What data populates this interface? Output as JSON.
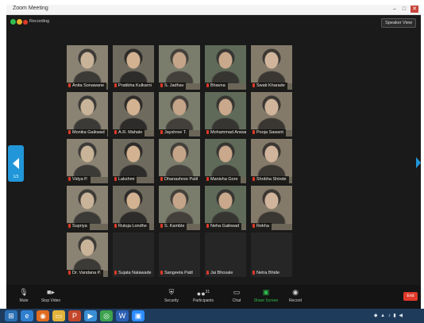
{
  "titlebar": {
    "app_title": "Zoom Meeting",
    "window_title": "",
    "minimize": "–",
    "maximize": "□",
    "close": "✕"
  },
  "topbar": {
    "recording_label": "Recording",
    "speaker_view_label": "Speaker View",
    "colors": {
      "recording": "#e0392b"
    }
  },
  "navigation": {
    "page_indicator": "1/3"
  },
  "gallery": {
    "tiles": [
      {
        "name": "Anita Sonawane",
        "video": true,
        "muted": true
      },
      {
        "name": "Pratibha Kulkarni",
        "video": true,
        "muted": true
      },
      {
        "name": "S. Jadhav",
        "video": true,
        "muted": true
      },
      {
        "name": "Bhavna",
        "video": true,
        "muted": true
      },
      {
        "name": "Swati Kharade",
        "video": true,
        "muted": true
      },
      {
        "name": "Monika Gaikwad",
        "video": true,
        "muted": true
      },
      {
        "name": "A.R. Mahale",
        "video": true,
        "muted": true
      },
      {
        "name": "Jayshree T.",
        "video": true,
        "muted": true
      },
      {
        "name": "Mohammad Anwar",
        "video": true,
        "muted": true
      },
      {
        "name": "Pooja Sawant",
        "video": true,
        "muted": true
      },
      {
        "name": "Vidya P.",
        "video": true,
        "muted": true
      },
      {
        "name": "Lakshmi",
        "video": true,
        "muted": true
      },
      {
        "name": "Dhanashree Patil",
        "video": true,
        "muted": true
      },
      {
        "name": "Manisha Gore",
        "video": true,
        "muted": true
      },
      {
        "name": "Shobha Shinde",
        "video": true,
        "muted": true
      },
      {
        "name": "Supriya",
        "video": true,
        "muted": true
      },
      {
        "name": "Rutuja Londhe",
        "video": true,
        "muted": true
      },
      {
        "name": "S. Kamble",
        "video": true,
        "muted": true
      },
      {
        "name": "Neha Gaikwad",
        "video": true,
        "muted": true
      },
      {
        "name": "Rekha",
        "video": true,
        "muted": true
      },
      {
        "name": "Dr. Vandana P.",
        "video": true,
        "muted": true
      },
      {
        "name": "Sujata Nalawade",
        "video": false,
        "muted": true
      },
      {
        "name": "Sangeeta Patil",
        "video": false,
        "muted": true
      },
      {
        "name": "Jai Bhosale",
        "video": false,
        "muted": true
      },
      {
        "name": "Netra Bhide",
        "video": false,
        "muted": true
      }
    ]
  },
  "toolbar": {
    "mute": "Mute",
    "stop_video": "Stop Video",
    "security": "Security",
    "participants": "Participants",
    "participants_count": "31",
    "chat": "Chat",
    "share_screen": "Share Screen",
    "record": "Record",
    "end": "End",
    "icons": {
      "mute": "microphone-icon",
      "video": "video-camera-icon",
      "security": "shield-icon",
      "participants": "people-icon",
      "chat": "chat-icon",
      "share": "share-screen-icon",
      "record": "record-icon"
    },
    "colors": {
      "share": "#2fbf4f",
      "end": "#e0392b"
    }
  },
  "taskbar": {
    "apps": [
      {
        "name": "start-button",
        "glyph": "⊞",
        "color": "#2a6fb4"
      },
      {
        "name": "edge-icon",
        "glyph": "e",
        "color": "#2f7fd0"
      },
      {
        "name": "firefox-icon",
        "glyph": "◉",
        "color": "#e06a1f"
      },
      {
        "name": "folder-icon",
        "glyph": "▭",
        "color": "#e2b33a"
      },
      {
        "name": "powerpoint-icon",
        "glyph": "P",
        "color": "#c4462a"
      },
      {
        "name": "media-player-icon",
        "glyph": "▶",
        "color": "#3a8fd4"
      },
      {
        "name": "chrome-icon",
        "glyph": "◎",
        "color": "#3da34e"
      },
      {
        "name": "word-icon",
        "glyph": "W",
        "color": "#2b5fb3"
      },
      {
        "name": "zoom-icon",
        "glyph": "▣",
        "color": "#2d8cff"
      }
    ],
    "tray": "◆ ▲ ♪ ▮ ◀",
    "clock_time": "",
    "clock_date": ""
  }
}
